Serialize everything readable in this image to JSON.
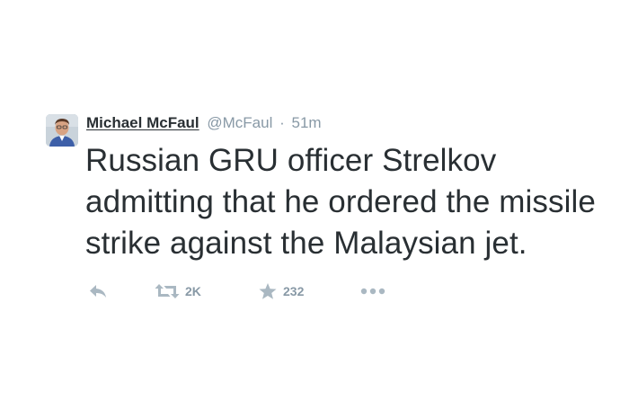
{
  "tweet": {
    "author": {
      "display_name": "Michael McFaul",
      "screen_name": "@McFaul",
      "avatar_icon": "profile-photo"
    },
    "separator": "·",
    "timestamp": "51m",
    "text_lines": [
      "Russian GRU officer Strelkov",
      "admitting that he ordered the missile",
      "strike against the Malaysian jet."
    ],
    "actions": {
      "reply_icon": "reply-icon",
      "retweet_icon": "retweet-icon",
      "retweet_count": "2K",
      "favorite_icon": "star-icon",
      "favorite_count": "232",
      "more_icon": "more-dots-icon"
    },
    "colors": {
      "text": "#292f33",
      "muted": "#8899a6",
      "icon": "#aab8c2"
    }
  }
}
